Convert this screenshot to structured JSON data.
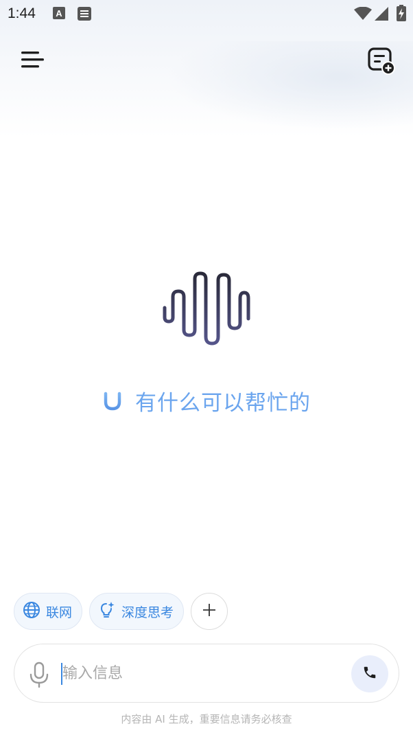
{
  "status_bar": {
    "time": "1:44",
    "icons": [
      "text-a-icon",
      "document-icon",
      "wifi-icon",
      "signal-icon",
      "battery-charging-icon"
    ]
  },
  "header": {
    "menu_icon": "hamburger-menu-icon",
    "new_chat_icon": "new-chat-icon"
  },
  "greeting": {
    "text": "有什么可以帮忙的"
  },
  "chips": [
    {
      "label": "联网",
      "icon": "globe-icon"
    },
    {
      "label": "深度思考",
      "icon": "lightbulb-icon"
    }
  ],
  "input": {
    "placeholder": "输入信息",
    "value": ""
  },
  "footer": {
    "disclaimer": "内容由 AI 生成，重要信息请务必核查"
  },
  "colors": {
    "accent": "#3a87e0",
    "greeting": "#6ba5ee",
    "chip_bg": "#f2f7fd",
    "call_bg": "#e9eefb"
  }
}
